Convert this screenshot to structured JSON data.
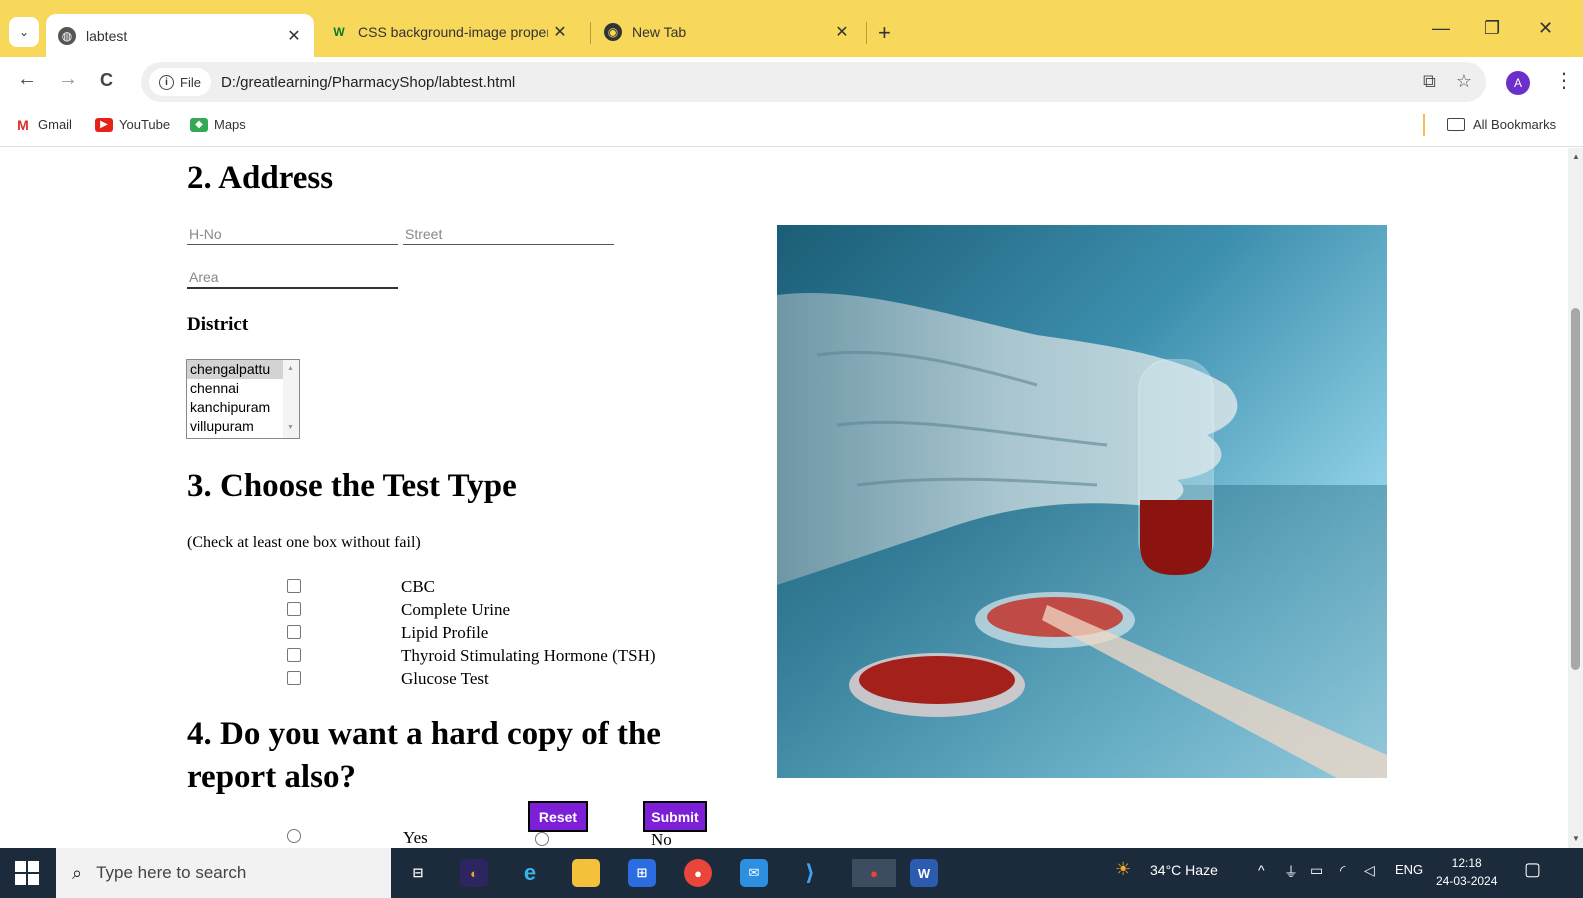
{
  "browser": {
    "tabs": [
      {
        "title": "labtest",
        "active": true
      },
      {
        "title": "CSS background-image propert",
        "active": false
      },
      {
        "title": "New Tab",
        "active": false
      }
    ],
    "window_controls": {
      "minimize": "—",
      "restore": "❐",
      "close": "✕"
    },
    "new_tab": "+",
    "nav": {
      "back": "←",
      "forward": "→",
      "reload": "C"
    },
    "address": {
      "chip_label": "File",
      "url": "D:/greatlearning/PharmacyShop/labtest.html"
    },
    "profile_initial": "A",
    "bookmarks": [
      {
        "label": "Gmail",
        "icon": "gmail-icon"
      },
      {
        "label": "YouTube",
        "icon": "youtube-icon"
      },
      {
        "label": "Maps",
        "icon": "maps-icon"
      }
    ],
    "all_bookmarks": "All Bookmarks"
  },
  "form": {
    "address_heading": "2. Address",
    "hno_placeholder": "H-No",
    "street_placeholder": "Street",
    "area_placeholder": "Area",
    "district_label": "District",
    "districts": [
      "chengalpattu",
      "chennai",
      "kanchipuram",
      "villupuram"
    ],
    "selected_district": "chengalpattu",
    "test_heading": "3. Choose the Test Type",
    "test_note": "(Check at least one box without fail)",
    "tests": [
      "CBC",
      "Complete Urine",
      "Lipid Profile",
      "Thyroid Stimulating Hormone (TSH)",
      "Glucose Test"
    ],
    "hardcopy_heading_line1": "4. Do you want a hard copy of the",
    "hardcopy_heading_line2": "report also?",
    "hardcopy_options": [
      "Yes",
      "No"
    ],
    "reset_label": "Reset",
    "submit_label": "Submit"
  },
  "taskbar": {
    "search_placeholder": "Type here to search",
    "weather": "34°C  Haze",
    "language": "ENG",
    "time": "12:18",
    "date": "24-03-2024"
  },
  "colors": {
    "tabstrip": "#f8d85a",
    "button_purple": "#7c1fd6",
    "taskbar": "#1c2b3c"
  }
}
